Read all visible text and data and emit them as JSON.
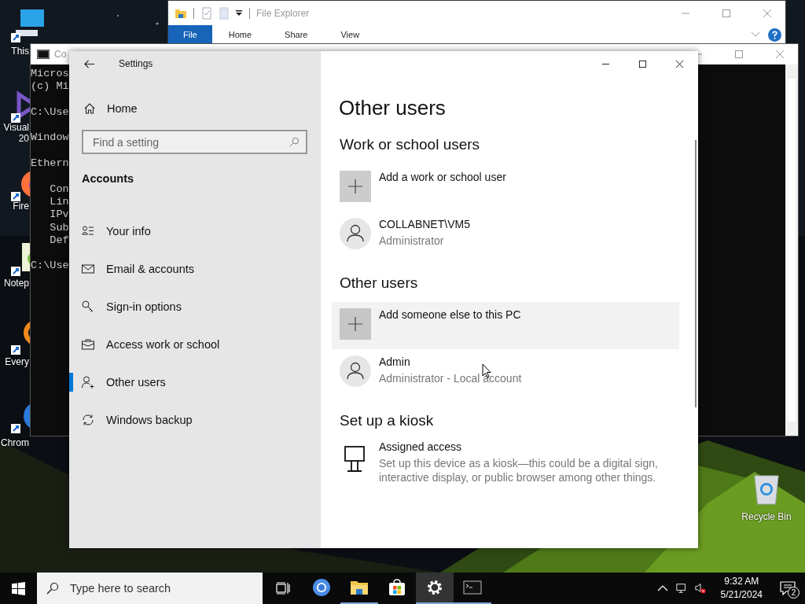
{
  "desktop_icons": [
    {
      "kind": "computer",
      "label": "This"
    },
    {
      "kind": "studio",
      "label": "Visual",
      "label_2": "20"
    },
    {
      "kind": "firefox",
      "label": "Fire"
    },
    {
      "kind": "notepad",
      "label": "Notep"
    },
    {
      "kind": "everything",
      "label": "Every"
    },
    {
      "kind": "chromium",
      "label": "Chrom"
    }
  ],
  "recycle_bin": {
    "label": "Recycle Bin"
  },
  "file_explorer": {
    "title": "File Explorer",
    "ribbon_tabs": [
      {
        "label": "File",
        "selected": true
      },
      {
        "label": "Home",
        "selected": false
      },
      {
        "label": "Share",
        "selected": false
      },
      {
        "label": "View",
        "selected": false
      }
    ]
  },
  "command_prompt": {
    "title": "Co",
    "blocks": [
      [
        "Micros",
        "(c) Mi"
      ],
      [
        "C:\\Use"
      ],
      [
        "Window"
      ],
      [
        "Ethern"
      ],
      [
        "   Con",
        "   Lin",
        "   IPv",
        "   Sub",
        "   Def"
      ],
      [
        "C:\\Use"
      ]
    ]
  },
  "settings": {
    "title": "Settings",
    "home": "Home",
    "search": {
      "placeholder": "Find a setting"
    },
    "section": "Accounts",
    "nav": [
      {
        "kind": "info",
        "label": "Your info",
        "selected": false
      },
      {
        "kind": "mail",
        "label": "Email & accounts",
        "selected": false
      },
      {
        "kind": "key",
        "label": "Sign-in options",
        "selected": false
      },
      {
        "kind": "briefcase",
        "label": "Access work or school",
        "selected": false
      },
      {
        "kind": "person-add",
        "label": "Other users",
        "selected": true
      },
      {
        "kind": "sync",
        "label": "Windows backup",
        "selected": false
      }
    ],
    "page_title": "Other users",
    "groups": [
      {
        "heading": "Work or school users",
        "items": [
          {
            "kind": "add",
            "title": "Add a work or school user",
            "hovered": false
          },
          {
            "kind": "user",
            "title": "COLLABNET\\VM5",
            "subtitle": "Administrator",
            "hovered": false
          }
        ]
      },
      {
        "heading": "Other users",
        "items": [
          {
            "kind": "add",
            "title": "Add someone else to this PC",
            "hovered": true
          },
          {
            "kind": "user",
            "title": "Admin",
            "subtitle": "Administrator - Local account",
            "hovered": false
          }
        ]
      },
      {
        "heading": "Set up a kiosk",
        "items": [
          {
            "kind": "kiosk",
            "title": "Assigned access",
            "subtitle": "Set up this device as a kiosk—this could be a digital sign, interactive display, or public browser among other things.",
            "hovered": false
          }
        ]
      }
    ]
  },
  "taskbar": {
    "search": {
      "placeholder": "Type here to search"
    },
    "apps": [
      {
        "kind": "chromium",
        "selected": false,
        "running": false
      },
      {
        "kind": "folder",
        "selected": false,
        "running": true
      },
      {
        "kind": "store",
        "selected": false,
        "running": false
      },
      {
        "kind": "settings",
        "selected": true,
        "running": true
      },
      {
        "kind": "terminal",
        "selected": false,
        "running": true
      }
    ],
    "clock": {
      "time": "9:32 AM",
      "date": "5/21/2024"
    },
    "notifications": "2"
  }
}
